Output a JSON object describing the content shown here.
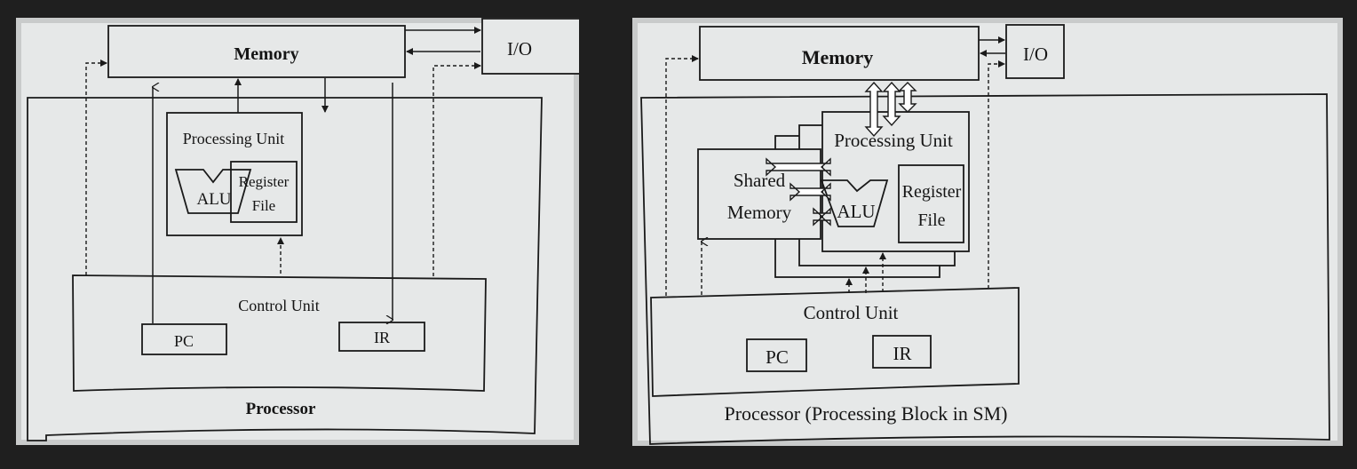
{
  "left_diagram": {
    "memory_label": "Memory",
    "io_label": "I/O",
    "processing_unit_label": "Processing Unit",
    "alu_label": "ALU",
    "register_file_line1": "Register",
    "register_file_line2": "File",
    "control_unit_label": "Control Unit",
    "pc_label": "PC",
    "ir_label": "IR",
    "processor_label": "Processor"
  },
  "right_diagram": {
    "memory_label": "Memory",
    "io_label": "I/O",
    "shared_memory_line1": "Shared",
    "shared_memory_line2": "Memory",
    "processing_unit_label": "Processing Unit",
    "alu_label": "ALU",
    "register_file_line1": "Register",
    "register_file_line2": "File",
    "control_unit_label": "Control Unit",
    "pc_label": "PC",
    "ir_label": "IR",
    "processor_label": "Processor (Processing Block in SM)"
  },
  "colors": {
    "page_background": "#e6e8e8",
    "outer_background": "#1f1f1f",
    "ink": "#1a1a1a"
  }
}
